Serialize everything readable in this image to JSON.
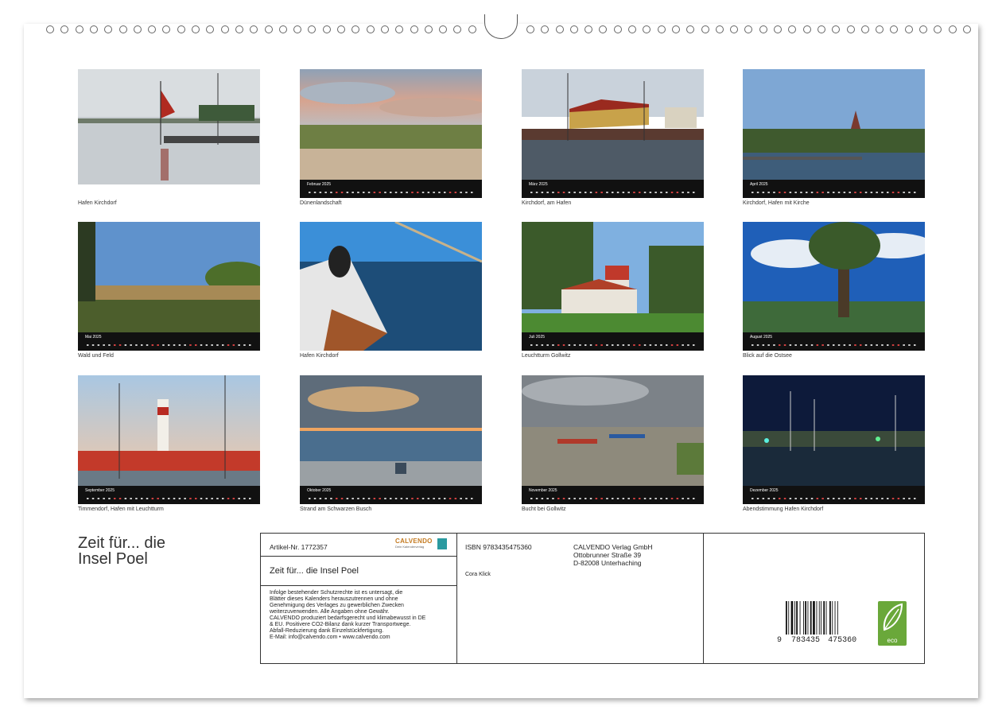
{
  "calendar": {
    "title": "Zeit für... die Insel Poel",
    "title_line1": "Zeit für... die",
    "title_line2": "Insel Poel"
  },
  "photos": [
    {
      "caption": "Hafen Kirchdorf",
      "month": ""
    },
    {
      "caption": "Dünenlandschaft",
      "month": "Februar 2025"
    },
    {
      "caption": "Kirchdorf, am Hafen",
      "month": "März 2025"
    },
    {
      "caption": "Kirchdorf, Hafen mit Kirche",
      "month": "April 2025"
    },
    {
      "caption": "Wald und Feld",
      "month": "Mai 2025"
    },
    {
      "caption": "Hafen Kirchdorf",
      "month": ""
    },
    {
      "caption": "Leuchtturm Gollwitz",
      "month": "Juli 2025"
    },
    {
      "caption": "Blick auf die Ostsee",
      "month": "August 2025"
    },
    {
      "caption": "Timmendorf, Hafen mit Leuchtturm",
      "month": "September 2025"
    },
    {
      "caption": "Strand am Schwarzen Busch",
      "month": "Oktober 2025"
    },
    {
      "caption": "Bucht bei Gollwitz",
      "month": "November 2025"
    },
    {
      "caption": "Abendstimmung Hafen Kirchdorf",
      "month": "Dezember 2025"
    }
  ],
  "imprint": {
    "article_no": "Artikel-Nr. 1772357",
    "brand": "CALVENDO",
    "brand_sub": "Dein Kalenderverlag",
    "product_title": "Zeit für... die Insel Poel",
    "legal_text": [
      "Infolge bestehender Schutzrechte ist es untersagt, die",
      "Blätter dieses Kalenders herauszutrennen und ohne",
      "Genehmigung des Verlages zu gewerblichen Zwecken",
      "weiterzuverwenden. Alle Angaben ohne Gewähr.",
      "CALVENDO produziert bedarfsgerecht und klimabewusst in DE",
      "& EU. Positivere CO2-Bilanz dank kurzer Transportwege.",
      "Abfall-Reduzierung dank Einzelstückfertigung.",
      "E-Mail: info@calvendo.com • www.calvendo.com"
    ],
    "isbn": "ISBN 9783435475360",
    "author": "Cora Klick",
    "publisher_name": "CALVENDO Verlag GmbH",
    "publisher_street": "Ottobrunner Straße 39",
    "publisher_city": "D-82008 Unterhaching",
    "barcode_digits_1": "9",
    "barcode_digits_2": "783435",
    "barcode_digits_3": "475360",
    "eco_label": "eco"
  },
  "colors": {
    "calendar_bar": "#111111",
    "eco_green": "#6aa83a"
  }
}
